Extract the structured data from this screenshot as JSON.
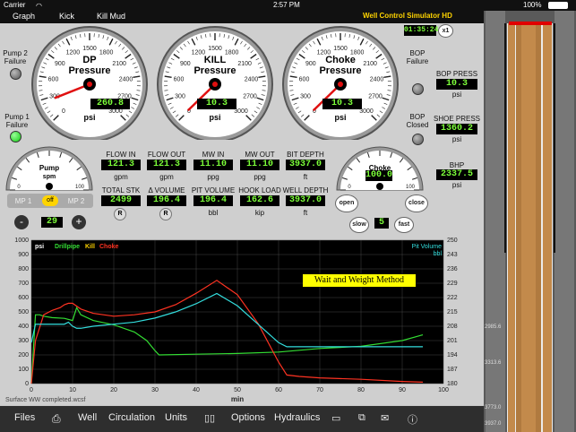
{
  "status": {
    "carrier": "Carrier",
    "time": "2:57 PM",
    "battery": "100%"
  },
  "menu": {
    "graph": "Graph",
    "kick": "Kick",
    "kill_mud": "Kill Mud",
    "app_title": "Well Control Simulator HD"
  },
  "clock": {
    "elapsed": "01:35:24",
    "speed": "x1"
  },
  "indicators": {
    "pump2": "Pump 2 Failure",
    "pump1": "Pump 1 Failure",
    "bop": "BOP Failure",
    "bop_closed": "BOP Closed"
  },
  "gauges": [
    {
      "title": "DP Pressure",
      "value": "260.8",
      "unit": "psi",
      "ticks": [
        "0",
        "300",
        "600",
        "900",
        "1200",
        "1500",
        "1800",
        "2100",
        "2400",
        "2700",
        "3000"
      ]
    },
    {
      "title": "KILL Pressure",
      "value": "10.3",
      "unit": "psi",
      "ticks": [
        "0",
        "300",
        "600",
        "900",
        "1200",
        "1500",
        "1800",
        "2100",
        "2400",
        "2700",
        "3000"
      ]
    },
    {
      "title": "Choke Pressure",
      "value": "10.3",
      "unit": "psi",
      "ticks": [
        "0",
        "300",
        "600",
        "900",
        "1200",
        "1500",
        "1800",
        "2100",
        "2400",
        "2700",
        "3000"
      ]
    }
  ],
  "right_readouts": [
    {
      "label": "BOP PRESS",
      "value": "10.3",
      "unit": "psi"
    },
    {
      "label": "SHOE PRESS",
      "value": "1360.2",
      "unit": "psi"
    },
    {
      "label": "BHP",
      "value": "2337.5",
      "unit": "psi"
    }
  ],
  "pump_gauge": {
    "title": "Pump spm",
    "ticks": [
      "0",
      "10",
      "20",
      "30",
      "40",
      "50",
      "60",
      "70",
      "80",
      "90",
      "100"
    ]
  },
  "choke_gauge": {
    "title": "Choke % open",
    "ticks": [
      "0",
      "10",
      "20",
      "30",
      "40",
      "50",
      "60",
      "70",
      "80",
      "90",
      "100"
    ],
    "value": "100.0"
  },
  "choke_controls": {
    "open": "open",
    "close": "close",
    "slow": "slow",
    "rate": "5",
    "fast": "fast"
  },
  "pump_controls": {
    "mp1": "MP 1",
    "off": "off",
    "mp2": "MP 2",
    "minus": "-",
    "rate": "29",
    "plus": "+"
  },
  "readouts_row1": [
    {
      "label": "FLOW IN",
      "value": "121.3",
      "unit": "gpm"
    },
    {
      "label": "FLOW OUT",
      "value": "121.3",
      "unit": "gpm"
    },
    {
      "label": "MW IN",
      "value": "11.10",
      "unit": "ppg"
    },
    {
      "label": "MW OUT",
      "value": "11.10",
      "unit": "ppg"
    },
    {
      "label": "BIT DEPTH",
      "value": "3937.0",
      "unit": "ft"
    }
  ],
  "readouts_row2": [
    {
      "label": "TOTAL STK",
      "value": "2499",
      "unit": "R"
    },
    {
      "label": "Δ VOLUME",
      "value": "196.4",
      "unit": "R"
    },
    {
      "label": "PIT VOLUME",
      "value": "196.4",
      "unit": "bbl"
    },
    {
      "label": "HOOK LOAD",
      "value": "162.6",
      "unit": "kip"
    },
    {
      "label": "WELL DEPTH",
      "value": "3937.0",
      "unit": "ft"
    }
  ],
  "chart_data": {
    "type": "line",
    "legend": [
      "psi",
      "Drillpipe",
      "Kill",
      "Choke"
    ],
    "legend_right": [
      "Pit Volume",
      "bbl"
    ],
    "annotation": "Wait and Weight Method",
    "xlabel": "min",
    "x_ticks": [
      0,
      10,
      20,
      30,
      40,
      50,
      60,
      70,
      80,
      90,
      100
    ],
    "y_left_ticks": [
      0,
      100,
      200,
      300,
      400,
      500,
      600,
      700,
      800,
      900,
      1000
    ],
    "y_right_ticks": [
      180,
      187,
      194,
      201,
      208,
      215,
      222,
      229,
      236,
      243,
      250
    ],
    "xlim": [
      0,
      100
    ],
    "ylim_left": [
      0,
      1000
    ],
    "ylim_right": [
      180,
      250
    ],
    "colors": {
      "drillpipe": "#33dd33",
      "kill": "#ffd400",
      "choke": "#ff3322",
      "pit": "#33dddd"
    },
    "series": [
      {
        "name": "Drillpipe",
        "axis": "left",
        "x": [
          0,
          1,
          2,
          3,
          5,
          8,
          10,
          11,
          12,
          15,
          20,
          25,
          28,
          30,
          31,
          40,
          50,
          60,
          70,
          80,
          90,
          95
        ],
        "y": [
          0,
          480,
          480,
          470,
          460,
          455,
          440,
          530,
          480,
          440,
          410,
          360,
          300,
          230,
          200,
          205,
          210,
          220,
          245,
          260,
          300,
          340
        ]
      },
      {
        "name": "Choke",
        "axis": "left",
        "x": [
          0,
          1,
          3,
          5,
          7,
          8,
          9,
          10,
          12,
          15,
          20,
          25,
          30,
          35,
          40,
          45,
          50,
          55,
          60,
          62,
          65,
          70,
          80,
          90,
          95
        ],
        "y": [
          0,
          300,
          480,
          510,
          530,
          550,
          560,
          560,
          520,
          490,
          470,
          480,
          500,
          550,
          630,
          720,
          620,
          420,
          150,
          60,
          50,
          40,
          30,
          15,
          10
        ]
      },
      {
        "name": "Pit Volume",
        "axis": "right",
        "x": [
          0,
          1,
          2,
          3,
          5,
          8,
          9,
          10,
          11,
          12,
          15,
          20,
          25,
          30,
          35,
          40,
          45,
          50,
          55,
          60,
          62,
          70,
          80,
          90,
          95
        ],
        "y": [
          200,
          209,
          209,
          209,
          209,
          209,
          210,
          208,
          207,
          207,
          208,
          209,
          210,
          212,
          215,
          219,
          224,
          218,
          209,
          200,
          198,
          198,
          198,
          198,
          198
        ]
      }
    ]
  },
  "chart_footer": "Surface WW completed.wcsf",
  "toolbar": {
    "files": "Files",
    "well": "Well",
    "circulation": "Circulation",
    "units": "Units",
    "options": "Options",
    "hydraulics": "Hydraulics"
  },
  "well_depths": [
    "2985.6",
    "3313.6",
    "3773.0",
    "3937.0"
  ]
}
